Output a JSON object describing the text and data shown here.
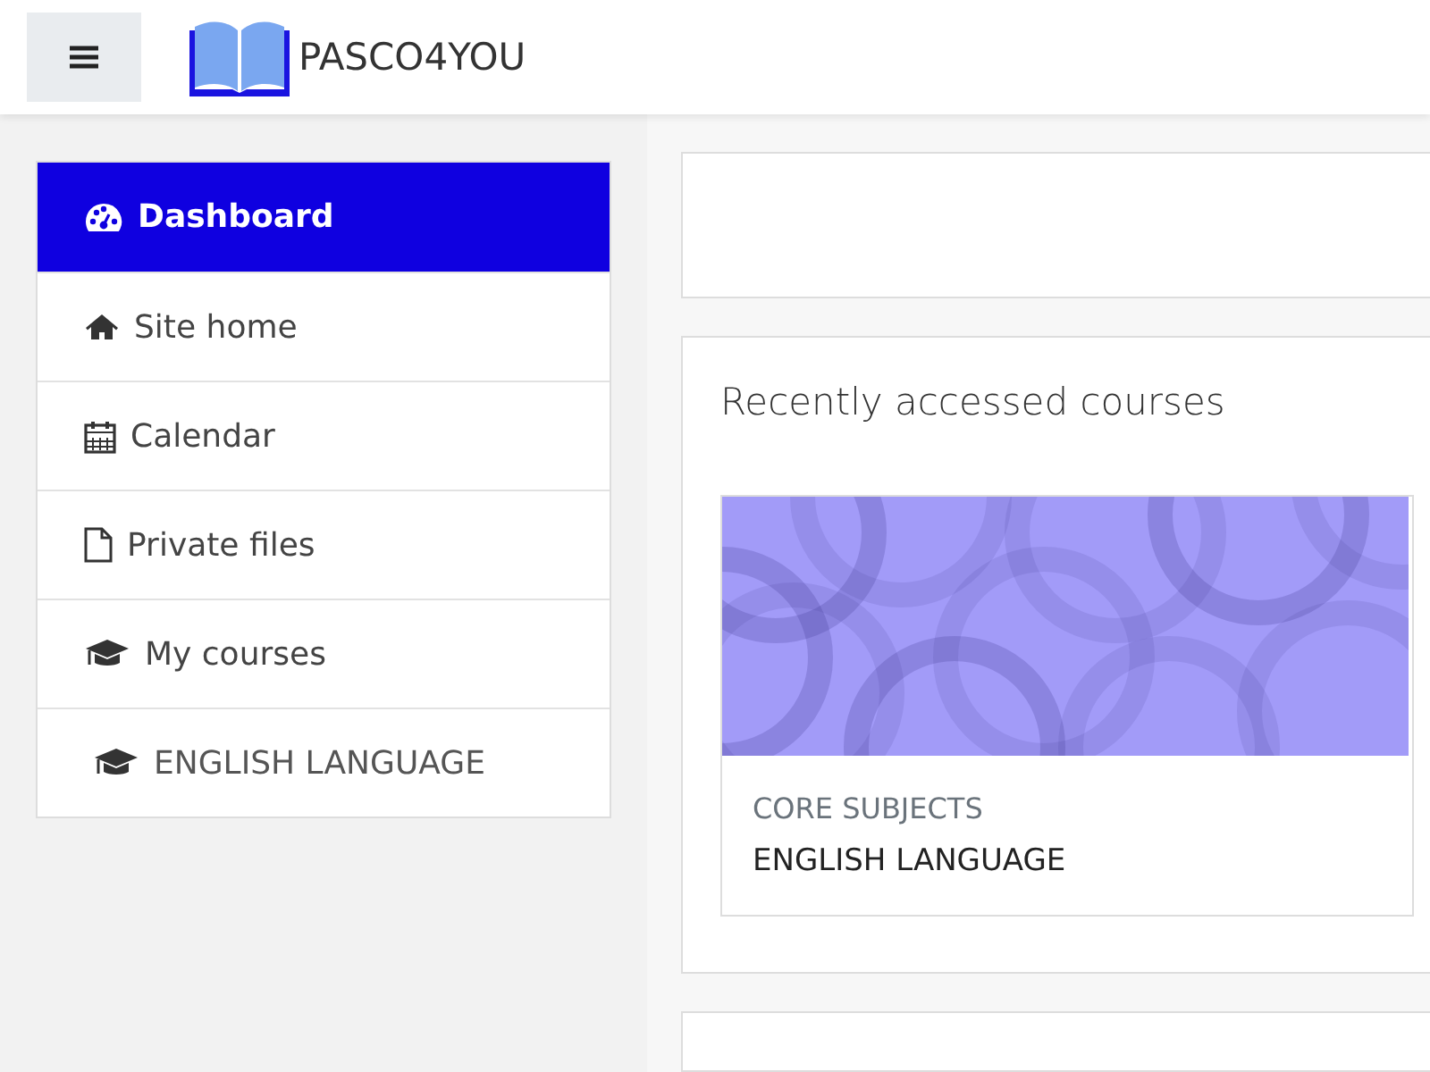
{
  "header": {
    "brand": "PASCO4YOU"
  },
  "nav": [
    {
      "kind": "dashboard",
      "label": "Dashboard",
      "selected": true
    },
    {
      "kind": "home",
      "label": "Site home",
      "selected": false
    },
    {
      "kind": "calendar",
      "label": "Calendar",
      "selected": false
    },
    {
      "kind": "file",
      "label": "Private files",
      "selected": false
    },
    {
      "kind": "courses",
      "label": "My courses",
      "selected": false,
      "children": [
        {
          "kind": "courses",
          "label": "ENGLISH LANGUAGE",
          "selected": false
        }
      ]
    }
  ],
  "recent": {
    "title": "Recently accessed courses",
    "courses": [
      {
        "category": "CORE SUBJECTS",
        "name": "ENGLISH LANGUAGE"
      }
    ]
  }
}
